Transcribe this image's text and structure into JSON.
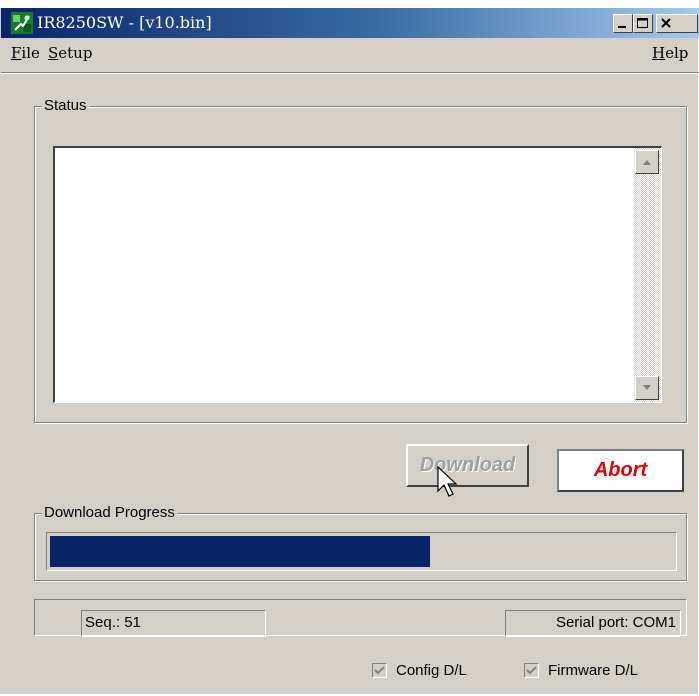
{
  "window": {
    "title": "IR8250SW - [v10.bin]",
    "app_icon": "app-logo-icon",
    "controls": [
      "minimize-icon",
      "maximize-icon",
      "close-icon"
    ]
  },
  "menu": {
    "file": "File",
    "setup": "Setup",
    "help": "Help"
  },
  "status_group": {
    "label": "Status",
    "text": ""
  },
  "buttons": {
    "download": "Download",
    "download_enabled": false,
    "abort": "Abort",
    "abort_color": "#e00000"
  },
  "progress": {
    "label": "Download Progress",
    "fraction": 0.61,
    "fill_color": "#0a246a"
  },
  "statusbar": {
    "seq": "Seq.: 51",
    "serial": "Serial port: COM1"
  },
  "checkboxes": [
    {
      "label": "Config D/L",
      "checked": true,
      "enabled": false
    },
    {
      "label": "Firmware D/L",
      "checked": true,
      "enabled": false
    }
  ]
}
